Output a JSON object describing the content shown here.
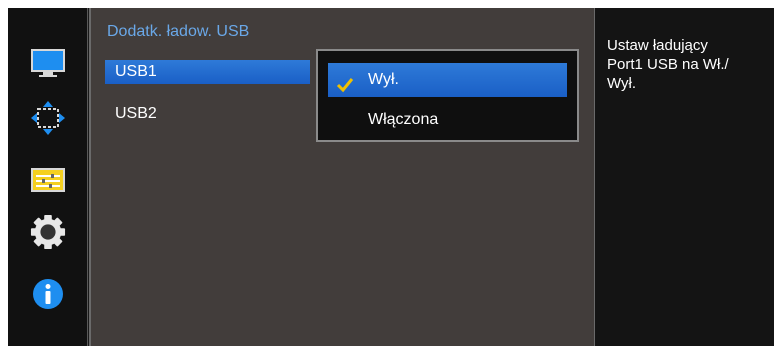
{
  "colors": {
    "accent": "#2e7ad8",
    "title": "#6aa8e8",
    "check": "#f0c000",
    "panel": "#423d3b"
  },
  "sidebar": {
    "icons": [
      "monitor-icon",
      "resize-arrows-icon",
      "settings-sliders-icon",
      "gear-icon",
      "info-icon"
    ]
  },
  "menu": {
    "title": "Dodatk. ładow. USB",
    "items": [
      {
        "label": "USB1",
        "selected": true
      },
      {
        "label": "USB2",
        "selected": false
      }
    ]
  },
  "dropdown": {
    "options": [
      {
        "label": "Wył.",
        "checked": true
      },
      {
        "label": "Włączona",
        "checked": false
      }
    ]
  },
  "help": {
    "text": "Ustaw ładujący\nPort1 USB na Wł./\nWył."
  }
}
